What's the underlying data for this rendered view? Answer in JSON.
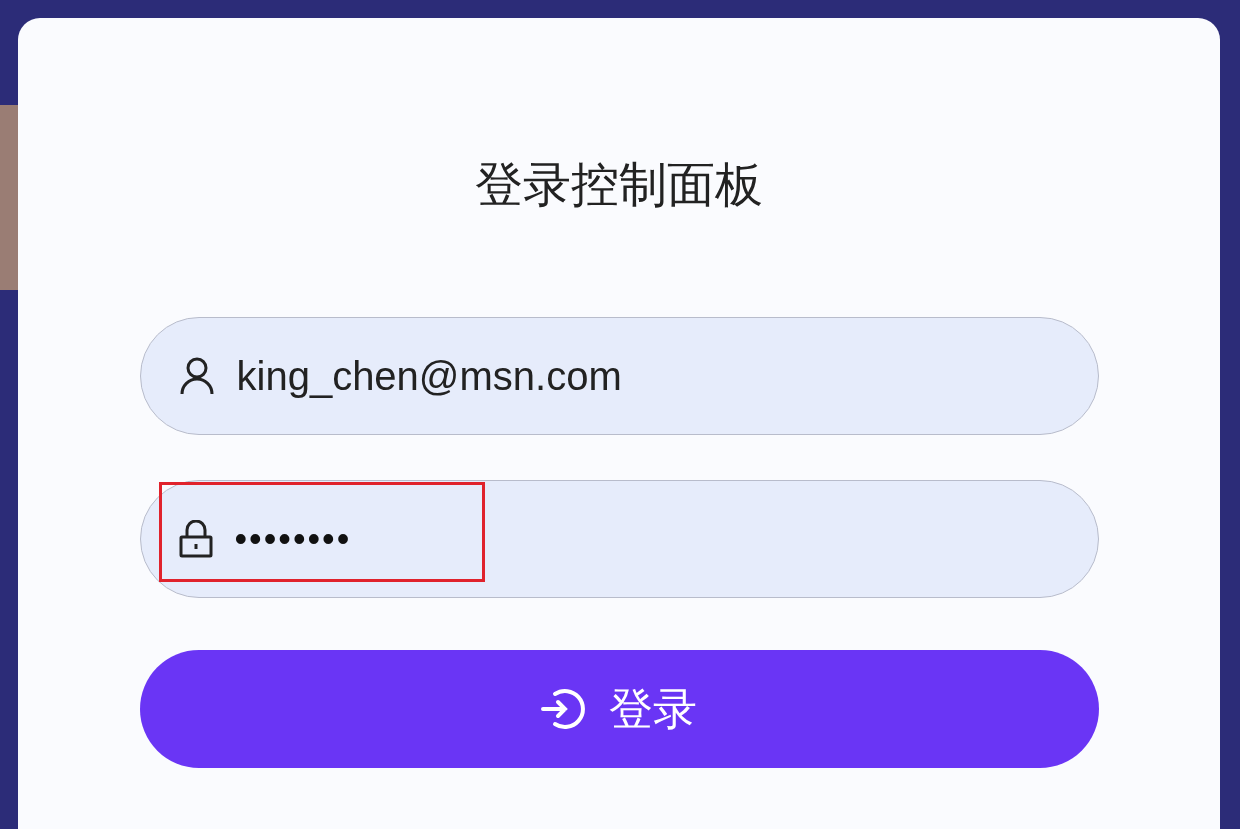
{
  "dialog": {
    "title": "登录控制面板"
  },
  "fields": [
    {
      "kind": "user",
      "value": "king_chen@msn.com",
      "highlighted": false
    },
    {
      "kind": "password",
      "value": "••••••••",
      "highlighted": true
    }
  ],
  "login_button": {
    "label": "登录"
  }
}
